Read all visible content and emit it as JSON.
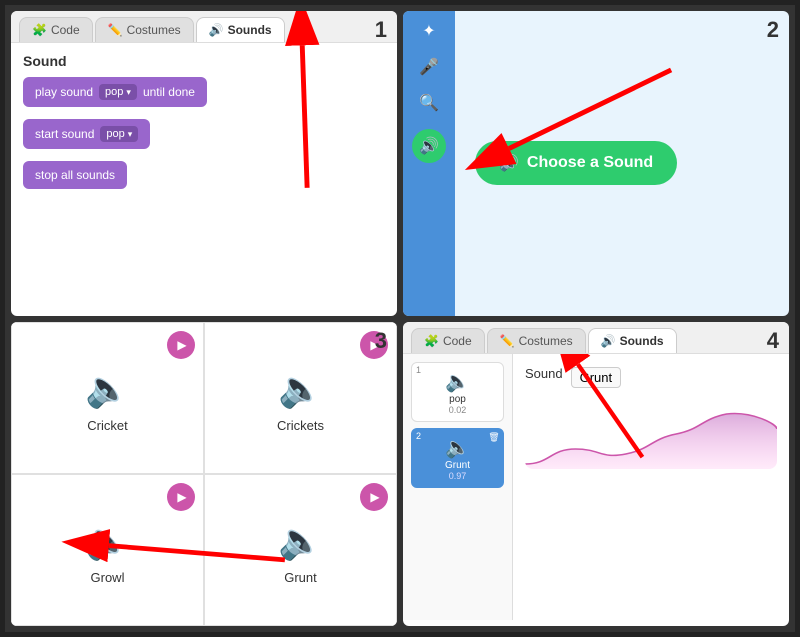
{
  "panels": {
    "p1": {
      "number": "1",
      "tabs": [
        {
          "label": "Code",
          "icon": "🧩",
          "active": false
        },
        {
          "label": "Costumes",
          "icon": "✏️",
          "active": false
        },
        {
          "label": "Sounds",
          "icon": "🔊",
          "active": true
        }
      ],
      "section_label": "Sound",
      "blocks": [
        {
          "text_before": "play sound",
          "chip": "pop",
          "text_after": "until done"
        },
        {
          "text_before": "start sound",
          "chip": "pop",
          "text_after": ""
        },
        {
          "text_only": "stop all sounds"
        }
      ]
    },
    "p2": {
      "number": "2",
      "choose_sound_label": "Choose a Sound",
      "sidebar_label": "Sounds"
    },
    "p3": {
      "number": "3",
      "sounds": [
        {
          "name": "Cricket"
        },
        {
          "name": "Crickets"
        },
        {
          "name": "Growl"
        },
        {
          "name": "Grunt"
        }
      ]
    },
    "p4": {
      "number": "4",
      "tabs": [
        {
          "label": "Code",
          "icon": "🧩",
          "active": false
        },
        {
          "label": "Costumes",
          "icon": "✏️",
          "active": false
        },
        {
          "label": "Sounds",
          "icon": "🔊",
          "active": true
        }
      ],
      "sound_label": "Sound",
      "sound_name": "Grunt",
      "sounds_list": [
        {
          "name": "pop",
          "duration": "0.02",
          "num": "1",
          "selected": false
        },
        {
          "name": "Grunt",
          "duration": "0.97",
          "num": "2",
          "selected": true
        }
      ]
    }
  }
}
